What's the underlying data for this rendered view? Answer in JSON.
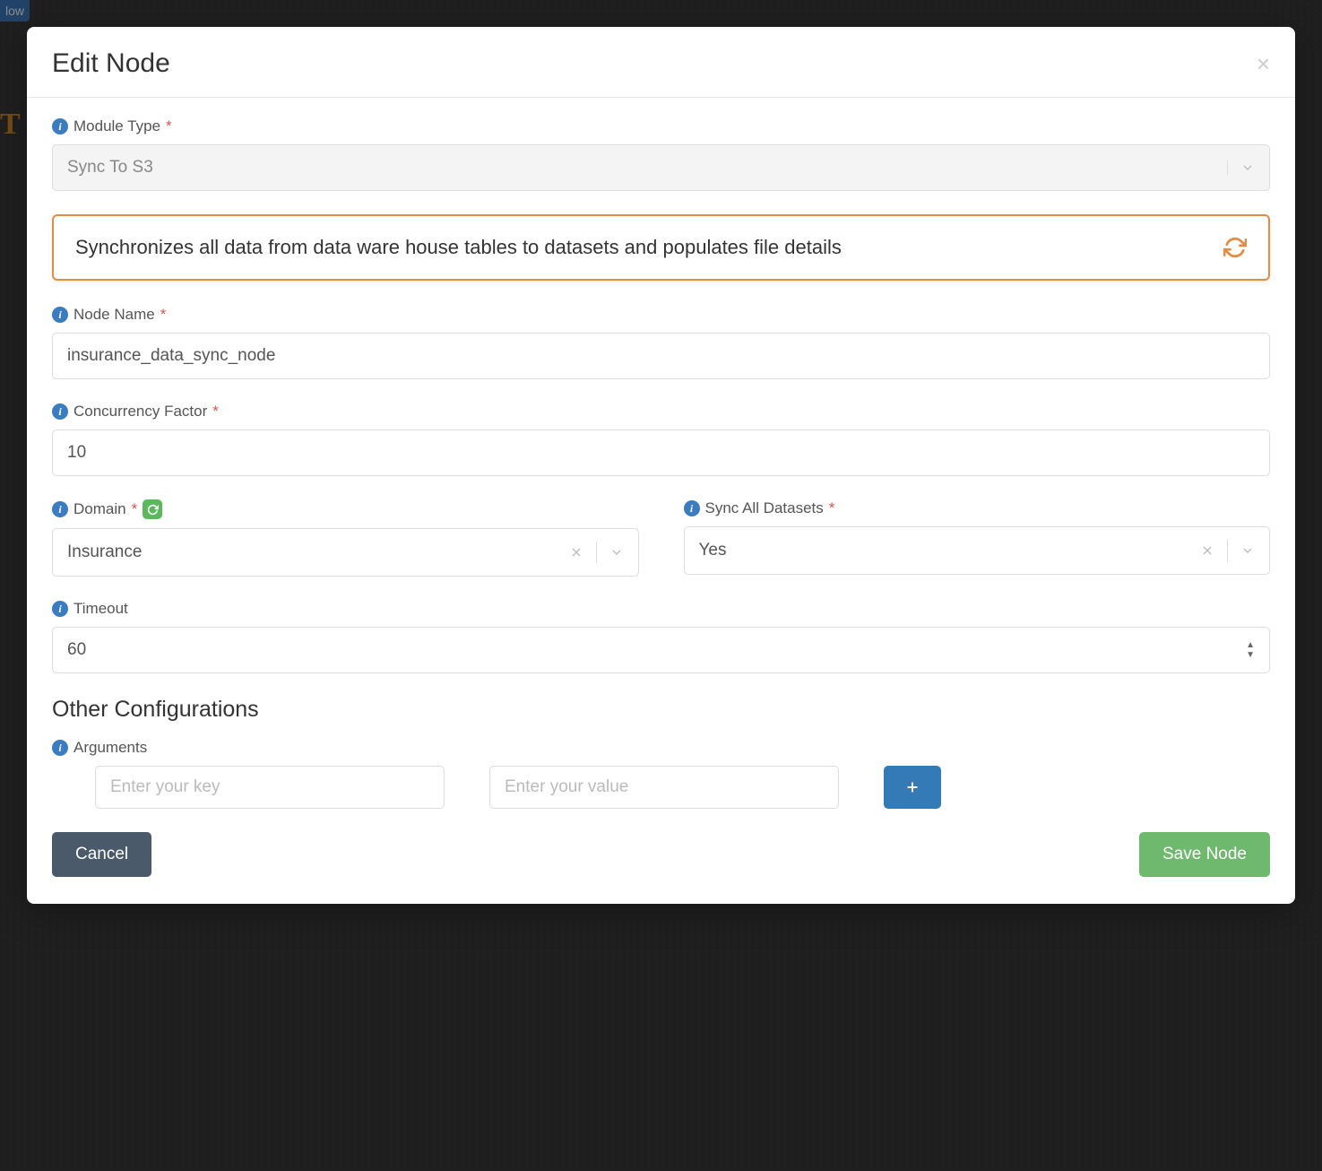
{
  "background": {
    "tag_text": "low"
  },
  "modal": {
    "title": "Edit Node",
    "fields": {
      "module_type": {
        "label": "Module Type",
        "required": true,
        "value": "Sync To S3"
      },
      "description": "Synchronizes all data from data ware house tables to datasets and populates file details",
      "node_name": {
        "label": "Node Name",
        "required": true,
        "value": "insurance_data_sync_node"
      },
      "concurrency": {
        "label": "Concurrency Factor",
        "required": true,
        "value": "10"
      },
      "domain": {
        "label": "Domain",
        "required": true,
        "value": "Insurance"
      },
      "sync_all": {
        "label": "Sync All Datasets",
        "required": true,
        "value": "Yes"
      },
      "timeout": {
        "label": "Timeout",
        "value": "60"
      }
    },
    "other_config": {
      "title": "Other Configurations",
      "arguments_label": "Arguments",
      "key_placeholder": "Enter your key",
      "value_placeholder": "Enter your value"
    },
    "buttons": {
      "cancel": "Cancel",
      "save": "Save Node"
    }
  }
}
